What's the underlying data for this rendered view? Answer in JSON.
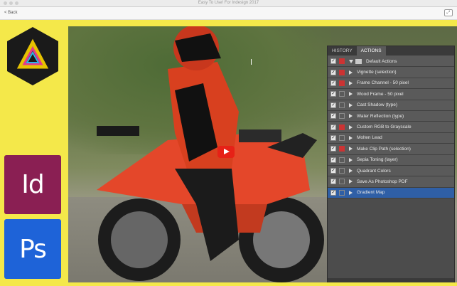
{
  "window": {
    "title": "Easy To Use! For Indesign 2017"
  },
  "nav": {
    "back_label": "< Back"
  },
  "apps": {
    "indesign_label": "Id",
    "photoshop_label": "Ps"
  },
  "colors": {
    "page_bg": "#f4e84a",
    "indesign": "#8a1f53",
    "photoshop": "#1e63d8",
    "play_red": "#e62117",
    "selected_row": "#2f5fa6"
  },
  "panel": {
    "tabs": [
      {
        "label": "HISTORY"
      },
      {
        "label": "ACTIONS"
      }
    ],
    "rows": [
      {
        "label": "Default Actions"
      },
      {
        "label": "Vignette (selection)"
      },
      {
        "label": "Frame Channel - 50 pixel"
      },
      {
        "label": "Wood Frame - 50 pixel"
      },
      {
        "label": "Cast Shadow (type)"
      },
      {
        "label": "Water Reflection (type)"
      },
      {
        "label": "Custom RGB to Grayscale"
      },
      {
        "label": "Molten Lead"
      },
      {
        "label": "Make Clip Path (selection)"
      },
      {
        "label": "Sepia Toning (layer)"
      },
      {
        "label": "Quadrant Colors"
      },
      {
        "label": "Save As Photoshop PDF"
      },
      {
        "label": "Gradient Map"
      }
    ]
  }
}
